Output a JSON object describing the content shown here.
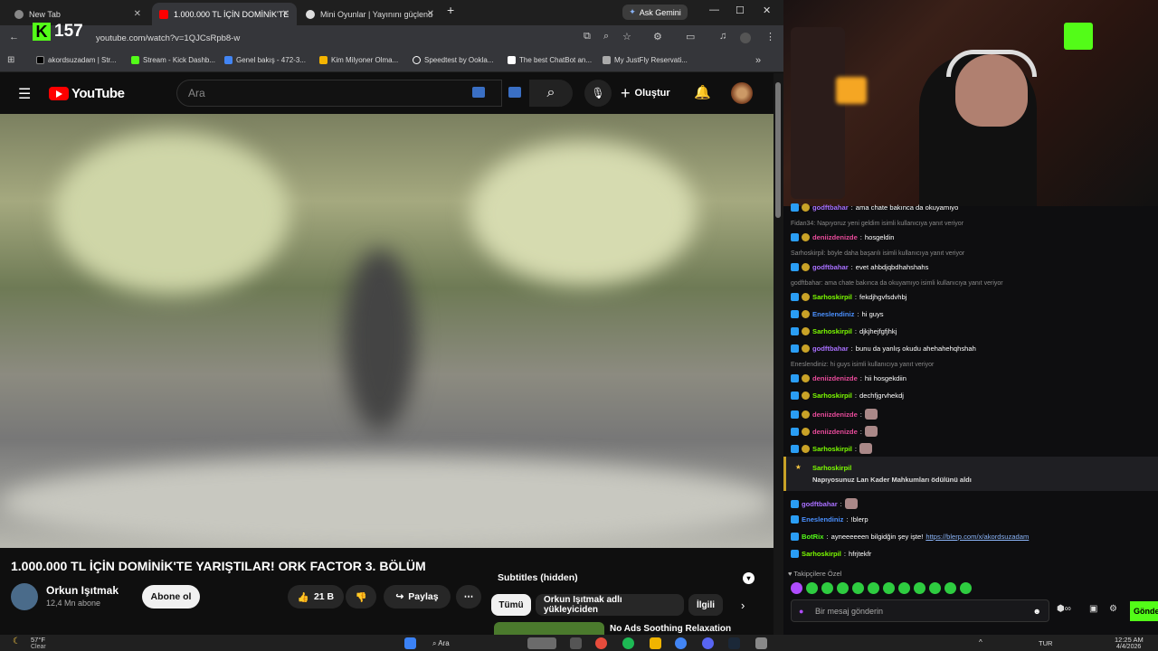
{
  "tabs": [
    {
      "label": "New Tab",
      "color": "#888888"
    },
    {
      "label": "1.000.000 TL İÇİN DOMİNİK'TE",
      "color": "#ff0000"
    },
    {
      "label": "Mini Oyunlar | Yayınını güçlend",
      "color": "#dddddd"
    }
  ],
  "gemini_label": "Ask Gemini",
  "kick": {
    "count": "157"
  },
  "url": "youtube.com/watch?v=1QJCsRpb8-w",
  "bookmarks": [
    {
      "label": "akordsuzadam | Str...",
      "color": "#000000"
    },
    {
      "label": "Stream - Kick Dashb...",
      "color": "#53fc18"
    },
    {
      "label": "Genel bakış - 472-3...",
      "color": "#4285f4"
    },
    {
      "label": "Kim Milyoner Olma...",
      "color": "#f4b400"
    },
    {
      "label": "Speedtest by Ookla...",
      "color": "#ffffff"
    },
    {
      "label": "The best ChatBot an...",
      "color": "#ffffff"
    },
    {
      "label": "My JustFly Reservati...",
      "color": "#aaaaaa"
    }
  ],
  "youtube": {
    "logo_text": "YouTube",
    "search_placeholder": "Ara",
    "create_label": "Oluştur",
    "video_title": "1.000.000 TL İÇİN DOMİNİK'TE YARIŞTILAR! ORK FACTOR 3. BÖLÜM",
    "channel_name": "Orkun Işıtmak",
    "channel_subs": "12,4 Mn abone",
    "subscribe_label": "Abone ol",
    "likes": "21 B",
    "share_label": "Paylaş",
    "subtitles_label": "Subtitles (hidden)",
    "chips": [
      "Tümü",
      "Orkun Işıtmak adlı yükleyiciden",
      "İlgili"
    ],
    "rec_title": "No Ads Soothing Relaxation"
  },
  "chat": {
    "messages": [
      {
        "type": "msg",
        "user": "godftbahar",
        "color": "#a970ff",
        "text": "ama chate bakınca da okuyamıyo"
      },
      {
        "type": "reply",
        "text": "Fidan34: Napıyoruz yeni geldim isimli kullanıcıya yanıt veriyor"
      },
      {
        "type": "msg",
        "user": "deniizdenizde",
        "color": "#e94b9b",
        "text": "hosgeldin"
      },
      {
        "type": "reply",
        "text": "Sarhoskirpil: böyle daha başarılı isimli kullanıcıya yanıt veriyor"
      },
      {
        "type": "msg",
        "user": "godftbahar",
        "color": "#a970ff",
        "text": "evet ahbdjqbdhahshahs"
      },
      {
        "type": "reply",
        "text": "godftbahar: ama chate bakınca da okuyamıyo isimli kullanıcıya yanıt veriyor"
      },
      {
        "type": "msg",
        "user": "Sarhoskirpil",
        "color": "#7cfc00",
        "text": "fekdjhgvfsdvhbj"
      },
      {
        "type": "msg",
        "user": "Eneslendiniz",
        "color": "#4a90ff",
        "text": "hi guys"
      },
      {
        "type": "msg",
        "user": "Sarhoskirpil",
        "color": "#7cfc00",
        "text": "djkjhejfgfjhkj"
      },
      {
        "type": "msg",
        "user": "godftbahar",
        "color": "#a970ff",
        "text": "bunu da yanlış okudu ahehahehqhshah"
      },
      {
        "type": "reply",
        "text": "Eneslendiniz: hi guys isimli kullanıcıya yanıt veriyor"
      },
      {
        "type": "msg",
        "user": "deniizdenizde",
        "color": "#e94b9b",
        "text": "hii hosgekdiin"
      },
      {
        "type": "msg",
        "user": "Sarhoskirpil",
        "color": "#7cfc00",
        "text": "dechfjgrvhekdj"
      },
      {
        "type": "msg",
        "user": "deniizdenizde",
        "color": "#e94b9b",
        "text": ""
      },
      {
        "type": "msg",
        "user": "deniizdenizde",
        "color": "#e94b9b",
        "text": ""
      },
      {
        "type": "msg",
        "user": "Sarhoskirpil",
        "color": "#7cfc00",
        "text": ""
      },
      {
        "type": "msg",
        "user": "Sarhoskirpil",
        "color": "#7cfc00",
        "text": ""
      }
    ],
    "redeem_user": "Sarhoskirpil",
    "redeem_text": "Napıyosunuz Lan Kader Mahkumları ödülünü aldı",
    "after": [
      {
        "user": "godftbahar",
        "color": "#a970ff",
        "text": ""
      },
      {
        "user": "Eneslendiniz",
        "color": "#4a90ff",
        "text": "!blerp"
      },
      {
        "user": "BotRix",
        "color": "#53fc18",
        "text": "ayneeeeeen bilgidğin şey işte!",
        "link": "https://blerp.com/x/akordsuzadam"
      },
      {
        "user": "Sarhoskirpil",
        "color": "#7cfc00",
        "text": "hfrjtekfr"
      }
    ],
    "followers_label": "Takipçilere Özel",
    "input_placeholder": "Bir mesaj gönderin",
    "send_label": "Gönder"
  },
  "taskbar": {
    "weather_temp": "57°F",
    "weather_cond": "Clear",
    "search": "Ara",
    "lang": "TUR",
    "time": "12:25 AM",
    "date": "4/4/2026"
  }
}
